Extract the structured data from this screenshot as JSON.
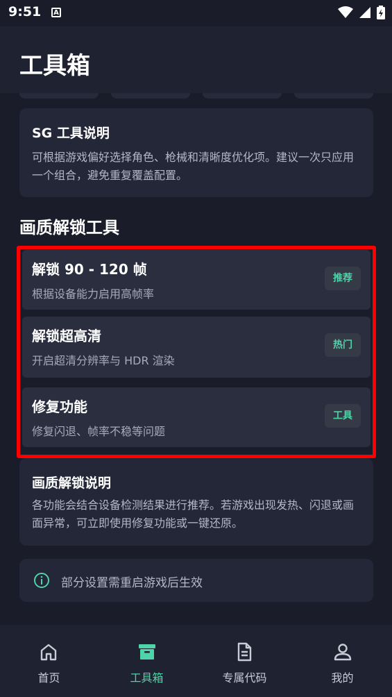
{
  "status": {
    "time": "9:51",
    "notif_icon": "A"
  },
  "appbar": {
    "title": "工具箱"
  },
  "sg_card": {
    "title": "SG 工具说明",
    "text": "可根据游戏偏好选择角色、枪械和清晰度优化项。建议一次只应用一个组合，避免重复覆盖配置。"
  },
  "section": {
    "title": "画质解锁工具"
  },
  "tools": [
    {
      "title": "解锁 90 - 120 帧",
      "desc": "根据设备能力启用高帧率",
      "badge": "推荐"
    },
    {
      "title": "解锁超高清",
      "desc": "开启超清分辨率与 HDR 渲染",
      "badge": "热门"
    },
    {
      "title": "修复功能",
      "desc": "修复闪退、帧率不稳等问题",
      "badge": "工具"
    }
  ],
  "unlock_card": {
    "title": "画质解锁说明",
    "text": "各功能会结合设备检测结果进行推荐。若游戏出现发热、闪退或画面异常，可立即使用修复功能或一键还原。"
  },
  "info": {
    "text": "部分设置需重启游戏后生效",
    "icon": "info-circle-icon"
  },
  "nav": [
    {
      "label": "首页",
      "icon": "home-icon"
    },
    {
      "label": "工具箱",
      "icon": "toolbox-icon",
      "active": true
    },
    {
      "label": "专属代码",
      "icon": "document-icon"
    },
    {
      "label": "我的",
      "icon": "person-icon"
    }
  ],
  "colors": {
    "accent": "#4fd3a8",
    "background": "#1a1d29",
    "card": "#232737",
    "highlight": "#ff0000"
  }
}
